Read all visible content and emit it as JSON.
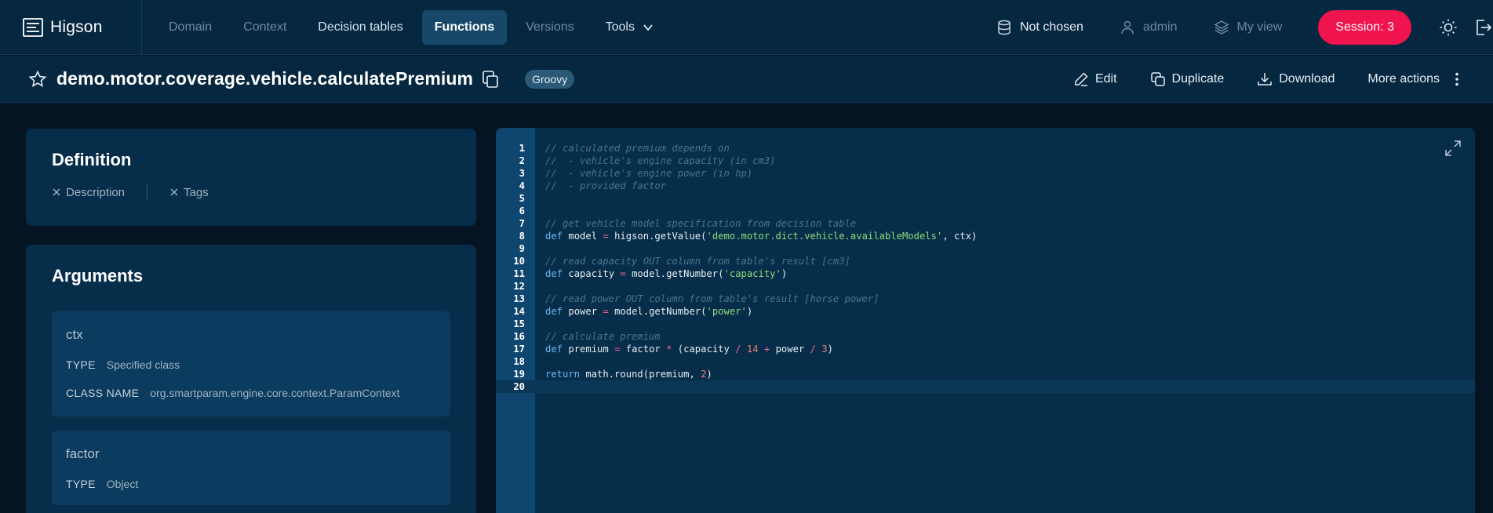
{
  "app": {
    "name": "Higson",
    "nav_tabs": [
      {
        "label": "Domain"
      },
      {
        "label": "Context"
      },
      {
        "label": "Decision tables"
      },
      {
        "label": "Functions"
      },
      {
        "label": "Versions"
      },
      {
        "label": "Tools"
      }
    ],
    "database_label": "Not chosen",
    "user_label": "admin",
    "view_label": "My view",
    "session_label": "Session: 3"
  },
  "function": {
    "name": "demo.motor.coverage.vehicle.calculatePremium",
    "language": "Groovy",
    "actions": {
      "edit": "Edit",
      "duplicate": "Duplicate",
      "download": "Download",
      "more": "More actions"
    }
  },
  "definition": {
    "title": "Definition",
    "tags": [
      {
        "label": "Description"
      },
      {
        "label": "Tags"
      }
    ]
  },
  "arguments": {
    "title": "Arguments",
    "items": [
      {
        "name": "ctx",
        "type_key": "TYPE",
        "type": "Specified class",
        "class_key": "CLASS NAME",
        "class_name": "org.smartparam.engine.core.context.ParamContext"
      },
      {
        "name": "factor",
        "type_key": "TYPE",
        "type": "Object"
      }
    ]
  },
  "editor": {
    "line_numbers": [
      "1",
      "2",
      "3",
      "4",
      "5",
      "6",
      "7",
      "8",
      "9",
      "10",
      "11",
      "12",
      "13",
      "14",
      "15",
      "16",
      "17",
      "18",
      "19",
      "20"
    ],
    "lines": [
      "// calculated premium depends on",
      "//  - vehicle's engine capacity (in cm3)",
      "//  - vehicle's engine power (in hp)",
      "//  - provided factor",
      "",
      "",
      "// get vehicle model specification from decision table",
      "def model = higson.getValue('demo.motor.dict.vehicle.availableModels', ctx)",
      "",
      "// read capacity OUT column from table's result [cm3]",
      "def capacity = model.getNumber('capacity')",
      "",
      "// read power OUT column from table's result [horse power]",
      "def power = model.getNumber('power')",
      "",
      "// calculate premium",
      "def premium = factor * (capacity / 14 + power / 3)",
      "",
      "return math.round(premium, 2)",
      ""
    ]
  },
  "colors": {
    "accent": "#f0144e",
    "active_tab": "#17486a",
    "background": "#041422",
    "panel": "#062d4a"
  }
}
